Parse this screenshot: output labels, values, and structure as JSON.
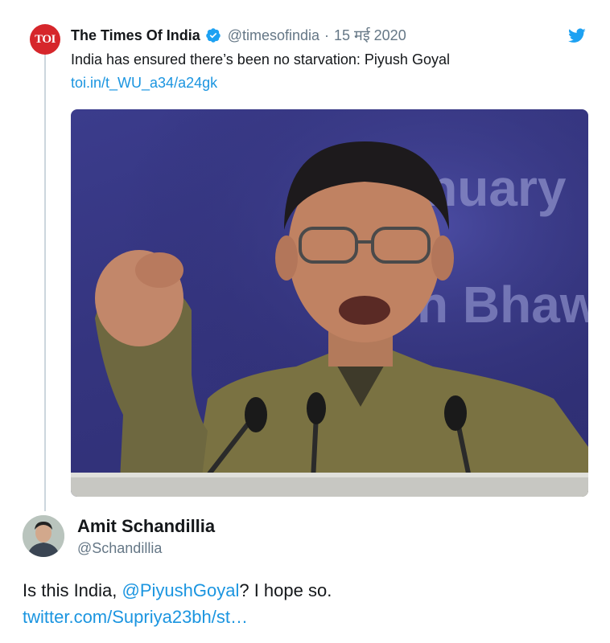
{
  "tweet": {
    "avatar_text": "TOI",
    "author_name": "The Times Of India",
    "handle": "@timesofindia",
    "separator": "·",
    "date": "15 मई 2020",
    "text": "India has ensured there’s been no starvation: Piyush Goyal",
    "link": "toi.in/t_WU_a34/a24gk",
    "photo": {
      "backdrop_text_1": "January",
      "backdrop_text_2": "n Bhaw"
    }
  },
  "reply": {
    "author_name": "Amit Schandillia",
    "handle": "@Schandillia",
    "text_prefix": "Is this India, ",
    "mention": "@PiyushGoyal",
    "text_suffix": "? I hope so.",
    "link": "twitter.com/Supriya23bh/st…"
  },
  "colors": {
    "link_blue": "#1b95e0",
    "toi_red": "#d6262b",
    "muted_gray": "#657786"
  },
  "icons": {
    "verified": "verified-badge-icon",
    "platform": "twitter-bird-icon"
  }
}
